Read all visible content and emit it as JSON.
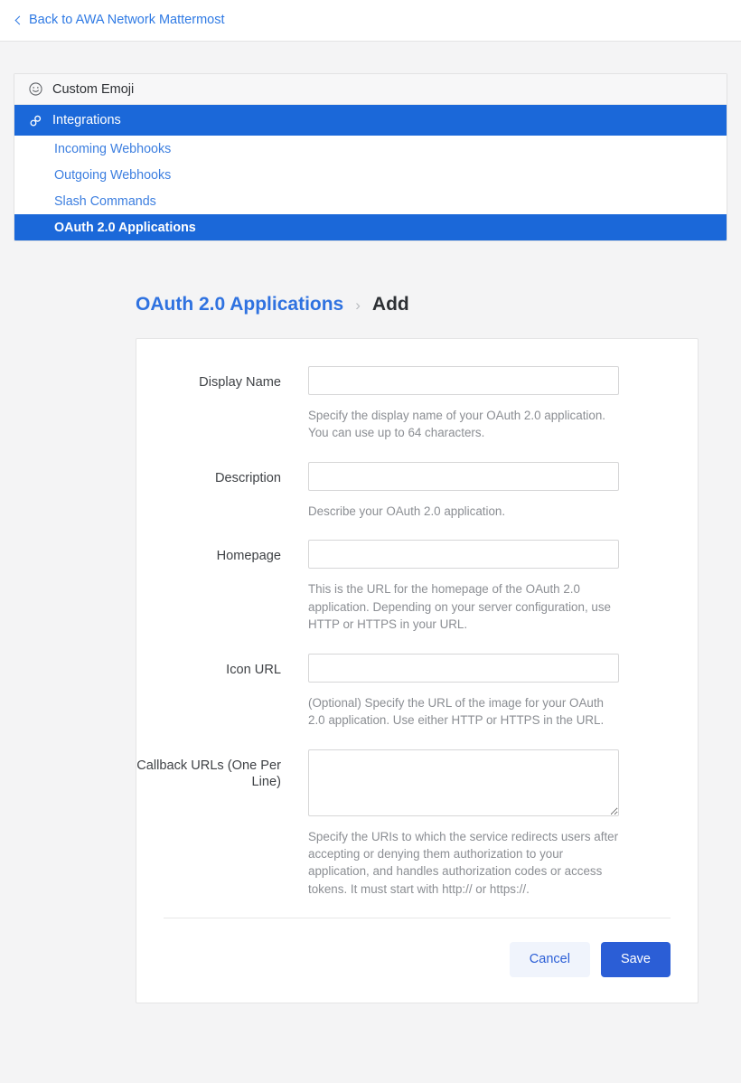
{
  "topbar": {
    "back_label": "Back to AWA Network Mattermost",
    "back_icon": "chevron-left-icon"
  },
  "nav": {
    "items": [
      {
        "label": "Custom Emoji",
        "icon": "smiley-face-icon",
        "active": false
      },
      {
        "label": "Integrations",
        "icon": "link-chain-icon",
        "active": true
      }
    ],
    "subitems": [
      {
        "label": "Incoming Webhooks",
        "active": false
      },
      {
        "label": "Outgoing Webhooks",
        "active": false
      },
      {
        "label": "Slash Commands",
        "active": false
      },
      {
        "label": "OAuth 2.0 Applications",
        "active": true
      }
    ]
  },
  "breadcrumb": {
    "parent": "OAuth 2.0 Applications",
    "separator": "›",
    "current": "Add"
  },
  "form": {
    "fields": [
      {
        "label": "Display Name",
        "value": "",
        "placeholder": "",
        "help": "Specify the display name of your OAuth 2.0 application. You can use up to 64 characters."
      },
      {
        "label": "Description",
        "value": "",
        "placeholder": "",
        "help": "Describe your OAuth 2.0 application."
      },
      {
        "label": "Homepage",
        "value": "",
        "placeholder": "",
        "help": "This is the URL for the homepage of the OAuth 2.0 application. Depending on your server configuration, use HTTP or HTTPS in your URL."
      },
      {
        "label": "Icon URL",
        "value": "",
        "placeholder": "",
        "help": "(Optional) Specify the URL of the image for your OAuth 2.0 application. Use either HTTP or HTTPS in the URL."
      },
      {
        "label": "Callback URLs (One Per Line)",
        "value": "",
        "placeholder": "",
        "help": "Specify the URIs to which the service redirects users after accepting or denying them authorization to your application, and handles authorization codes or access tokens. It must start with http:// or https://."
      }
    ],
    "cancel_label": "Cancel",
    "save_label": "Save"
  },
  "colors": {
    "accent_blue": "#1b68d9",
    "link_blue": "#2f7ae4",
    "save_blue": "#2b5ed6",
    "cancel_bg": "#f0f4fc",
    "page_bg": "#f4f4f5",
    "help_text": "#8b8e93"
  }
}
